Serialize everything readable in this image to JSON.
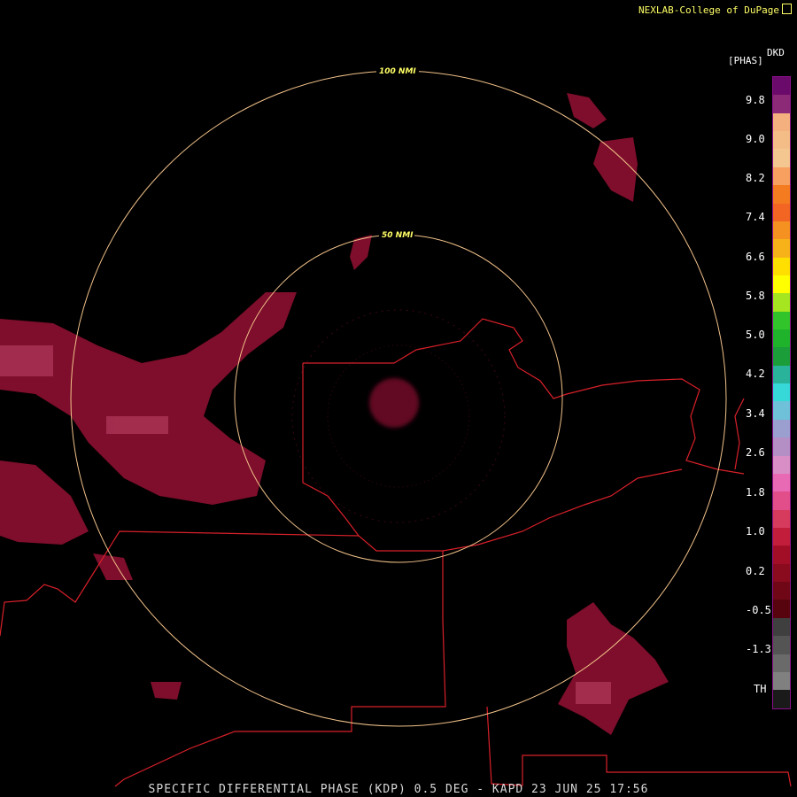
{
  "credit": "NEXLAB-College of DuPage",
  "legend": {
    "product": "DKD",
    "units": "[PHAS]",
    "ticks": [
      "9.8",
      "9.0",
      "8.2",
      "7.4",
      "6.6",
      "5.8",
      "5.0",
      "4.2",
      "3.4",
      "2.6",
      "1.8",
      "1.0",
      "0.2",
      "-0.5",
      "-1.3",
      "TH"
    ],
    "colors": [
      "#6a0a6a",
      "#8c2a78",
      "#f4b17f",
      "#f4bd88",
      "#f4c690",
      "#f7a060",
      "#f47b20",
      "#f26522",
      "#f59120",
      "#f7b21a",
      "#ffdf00",
      "#ffff00",
      "#a6e620",
      "#31c42b",
      "#1fb32b",
      "#1b9e3a",
      "#28b39a",
      "#36d8d8",
      "#6ec1d9",
      "#9a9fd0",
      "#b38fc6",
      "#d98fc6",
      "#e96ab4",
      "#e24e8a",
      "#d63b5e",
      "#c21d3a",
      "#a30e27",
      "#8a0a1e",
      "#6f0716",
      "#57040f",
      "#3f3f3f",
      "#545454",
      "#6a6a6a",
      "#808080",
      "#1a1a1a"
    ]
  },
  "rings": [
    {
      "label": "100 NMI"
    },
    {
      "label": "50 NMI"
    }
  ],
  "footer": "SPECIFIC DIFFERENTIAL PHASE (KDP) 0.5 DEG - KAPD 23 JUN 25 17:56"
}
